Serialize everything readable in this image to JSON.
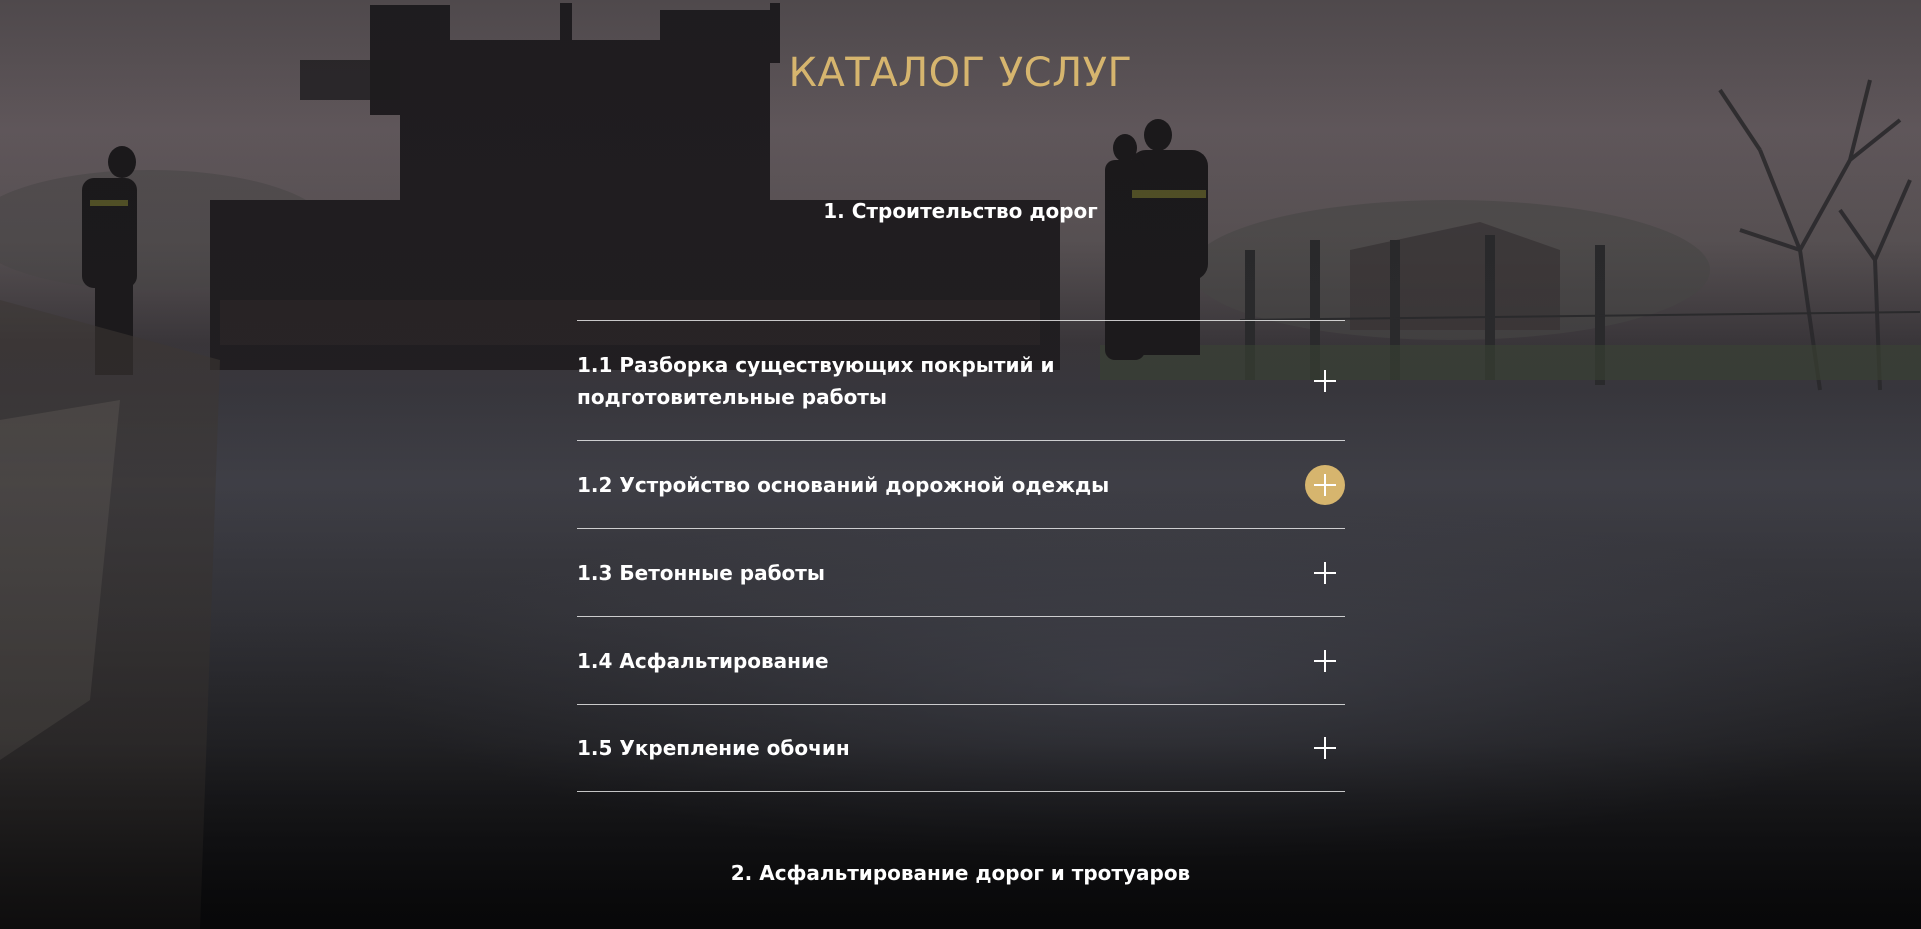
{
  "catalog": {
    "title": "КАТАЛОГ УСЛУГ"
  },
  "sections": [
    {
      "heading": "1. Строительство дорог",
      "items": [
        {
          "label": "1.1 Разборка существующих покрытий и подготовительные работы",
          "active": false,
          "icon": "plus-icon"
        },
        {
          "label": "1.2 Устройство оснований дорожной одежды",
          "active": true,
          "icon": "plus-icon"
        },
        {
          "label": "1.3 Бетонные работы",
          "active": false,
          "icon": "plus-icon"
        },
        {
          "label": "1.4 Асфальтирование",
          "active": false,
          "icon": "plus-icon"
        },
        {
          "label": "1.5 Укрепление обочин",
          "active": false,
          "icon": "plus-icon"
        }
      ]
    },
    {
      "heading": "2. Асфальтирование дорог и тротуаров"
    }
  ],
  "colors": {
    "accent": "#d6b56e",
    "text": "#ffffff",
    "divider": "rgba(255,255,255,0.75)"
  }
}
